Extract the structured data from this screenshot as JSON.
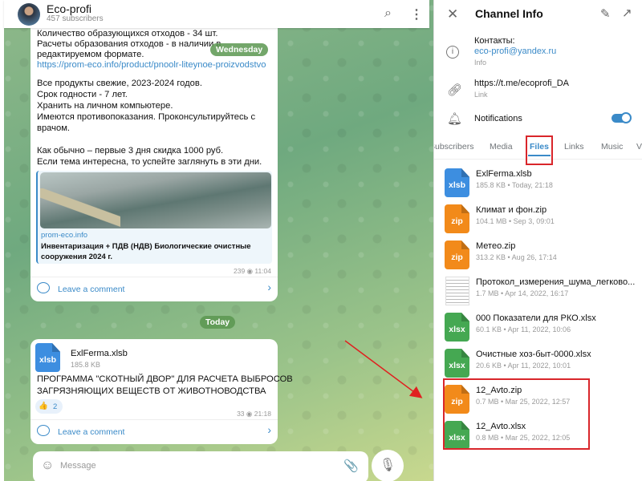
{
  "chat": {
    "title": "Eco-profi",
    "subtitle": "457 subscribers",
    "date_pills": [
      "Wednesday",
      "Today"
    ],
    "post1": {
      "lines": [
        "Количество образующихся отходов - 34 шт.",
        "Расчеты образования отходов - в наличии в",
        "редактируемом формате."
      ],
      "url": "https://prom-eco.info/product/pnoolr-liteynoe-proizvodstvo",
      "body": [
        "Все продукты свежие, 2023-2024 годов.",
        "Срок годности - 7 лет.",
        "Хранить на личном компьютере.",
        "Имеются противопоказания. Проконсультируйтесь с",
        "врачом.",
        "Как обычно – первые 3 дня скидка 1000 руб.",
        "Если тема интересна, то успейте заглянуть в эти дни."
      ],
      "preview_site": "prom-eco.info",
      "preview_title": [
        "Инвентаризация + ПДВ (НДВ) Биологические очистные",
        "сооружения 2024 г."
      ],
      "views": "239",
      "time": "11:04",
      "comment": "Leave a comment"
    },
    "post2": {
      "file_ext": "xlsb",
      "file_name": "ExlFerma.xlsb",
      "file_size": "185.8 KB",
      "caption": [
        "ПРОГРАММА \"СКОТНЫЙ ДВОР\" ДЛЯ РАСЧЕТА ВЫБРОСОВ",
        "ЗАГРЯЗНЯЮЩИХ ВЕЩЕСТВ ОТ ЖИВОТНОВОДСТВА"
      ],
      "reaction_emoji": "👍",
      "reaction_count": "2",
      "views": "33",
      "time": "21:18",
      "comment": "Leave a comment"
    },
    "composer_placeholder": "Message"
  },
  "panel": {
    "title": "Channel Info",
    "contacts_label": "Контакты:",
    "contacts_email": "eco-profi@yandex.ru",
    "contacts_caption": "Info",
    "link": "https://t.me/ecoprofi_DA",
    "link_caption": "Link",
    "notifications": "Notifications",
    "notifications_on": true,
    "tabs": [
      "Subscribers",
      "Media",
      "Files",
      "Links",
      "Music",
      "V"
    ],
    "active_tab": "Files",
    "files": [
      {
        "ext": "xlsb",
        "color": "blue",
        "name": "ExlFerma.xlsb",
        "meta": "185.8 KB • Today, 21:18"
      },
      {
        "ext": "zip",
        "color": "orange",
        "name": "Климат и фон.zip",
        "meta": "104.1 MB • Sep 3, 09:01"
      },
      {
        "ext": "zip",
        "color": "orange",
        "name": "Метео.zip",
        "meta": "313.2 KB • Aug 26, 17:14"
      },
      {
        "ext": "",
        "color": "doc",
        "name": "Протокол_измерения_шума_легково...",
        "meta": "1.7 MB • Apr 14, 2022, 16:17"
      },
      {
        "ext": "xlsx",
        "color": "green",
        "name": "000 Показатели для РКО.xlsx",
        "meta": "60.1 KB • Apr 11, 2022, 10:06"
      },
      {
        "ext": "xlsx",
        "color": "green",
        "name": "Очистные хоз-быт-0000.xlsx",
        "meta": "20.6 KB • Apr 11, 2022, 10:01"
      },
      {
        "ext": "zip",
        "color": "orange",
        "name": "12_Avto.zip",
        "meta": "0.7 MB • Mar 25, 2022, 12:57"
      },
      {
        "ext": "xlsx",
        "color": "green",
        "name": "12_Avto.xlsx",
        "meta": "0.8 MB • Mar 25, 2022, 12:05"
      }
    ]
  },
  "colors": {
    "accent": "#3a8ac8",
    "highlight": "#d9262b"
  }
}
